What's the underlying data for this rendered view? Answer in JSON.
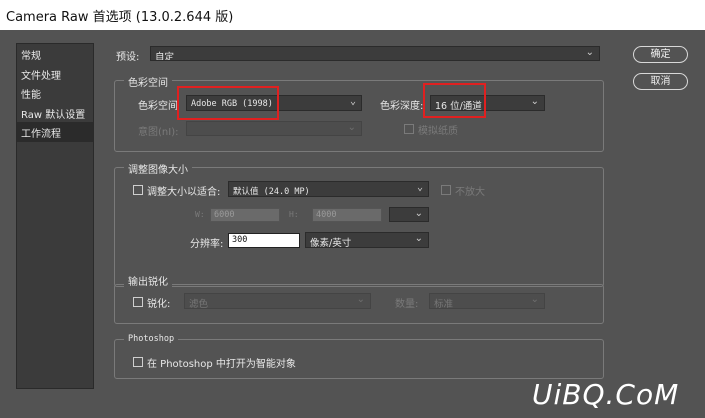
{
  "window": {
    "title": "Camera Raw 首选项  (13.0.2.644 版)"
  },
  "sidebar": {
    "items": [
      {
        "label": "常规"
      },
      {
        "label": "文件处理"
      },
      {
        "label": "性能"
      },
      {
        "label": "Raw 默认设置"
      },
      {
        "label": "工作流程"
      }
    ],
    "selected": "工作流程"
  },
  "preset": {
    "label": "预设:",
    "value": "自定"
  },
  "color_space_group": {
    "title": "色彩空间",
    "space_label": "色彩空间",
    "space_value": "Adobe RGB (1998)",
    "depth_label": "色彩深度:",
    "depth_value": "16 位/通道",
    "intent_label": "意图(nI):",
    "simulate_paper_label": "模拟纸质"
  },
  "resize_group": {
    "title": "调整图像大小",
    "fit_label": "调整大小以适合:",
    "fit_value": "默认值 (24.0 MP)",
    "no_enlarge_label": "不放大",
    "w_label": "W:",
    "w_value": "6000",
    "h_label": "H:",
    "h_value": "4000",
    "resolution_label": "分辨率:",
    "resolution_value": "300",
    "resolution_unit": "像素/英寸"
  },
  "sharpen_group": {
    "title": "输出锐化",
    "sharpen_label": "锐化:",
    "sharpen_for": "滤色",
    "amount_label": "数量:",
    "amount_value": "标准"
  },
  "photoshop_group": {
    "title": "Photoshop",
    "smart_object_label": "在 Photoshop 中打开为智能对象"
  },
  "buttons": {
    "ok": "确定",
    "cancel": "取消"
  },
  "watermark": "UiBQ.CoM",
  "colors": {
    "highlight": "#e02020",
    "panel": "#535353",
    "sidebar_bg": "#3b3b3b"
  }
}
